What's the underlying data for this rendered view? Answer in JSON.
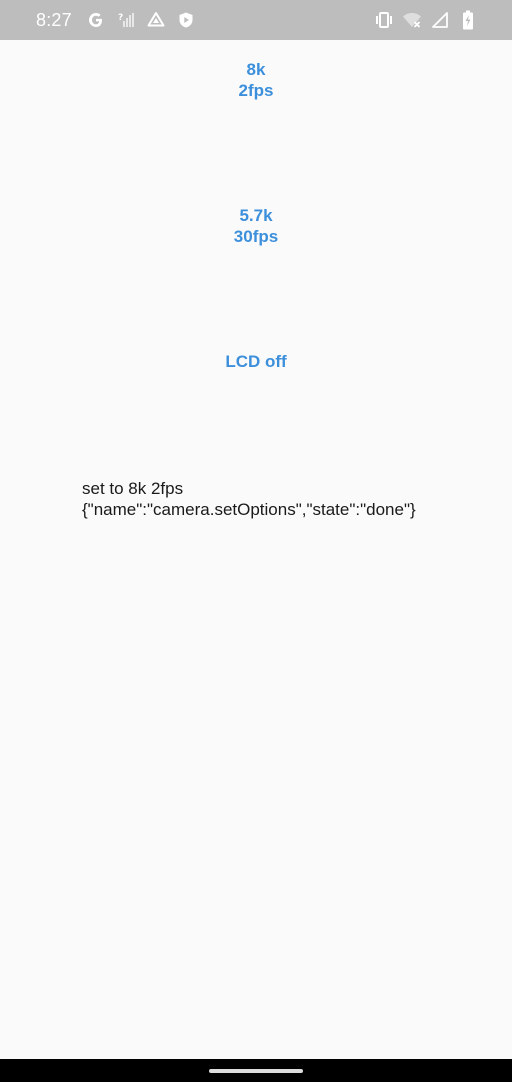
{
  "status_bar": {
    "time": "8:27",
    "left_icons": [
      "google-g-icon",
      "wifi-unknown-icon",
      "drive-icon",
      "shield-play-icon"
    ],
    "right_icons": [
      "vibrate-icon",
      "wifi-off-icon",
      "cell-signal-icon",
      "battery-charging-icon"
    ]
  },
  "buttons": {
    "resolution_8k": {
      "line1": "8k",
      "line2": "2fps"
    },
    "resolution_57k": {
      "line1": "5.7k",
      "line2": "30fps"
    },
    "lcd": {
      "label": "LCD off"
    }
  },
  "log": {
    "line1": "set to 8k 2fps",
    "line2": "{\"name\":\"camera.setOptions\",\"state\":\"done\"}"
  },
  "colors": {
    "accent": "#3c8fdb",
    "background": "#fafafa",
    "status_bar": "#bdbdbd",
    "nav_bar": "#000000"
  }
}
